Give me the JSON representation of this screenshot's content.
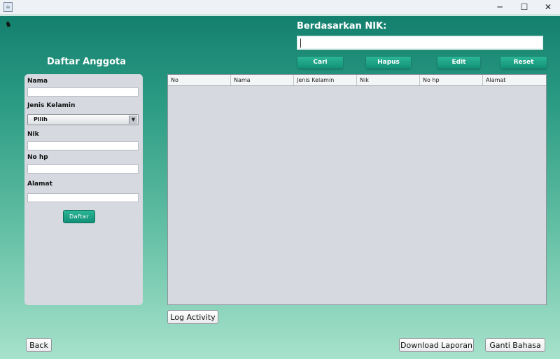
{
  "window": {
    "minimize_glyph": "─",
    "maximize_glyph": "☐",
    "close_glyph": "✕"
  },
  "search": {
    "heading": "Berdasarkan NIK:",
    "value": "",
    "buttons": {
      "cari": "Cari",
      "hapus": "Hapus",
      "edit": "Edit",
      "reset": "Reset"
    }
  },
  "form": {
    "title": "Daftar Anggota",
    "nama_label": "Nama",
    "nama_value": "",
    "jenis_kelamin_label": "Jenis Kelamin",
    "jenis_kelamin_selected": "Pilih",
    "nik_label": "Nik",
    "nik_value": "",
    "nohp_label": "No hp",
    "nohp_value": "",
    "alamat_label": "Alamat",
    "alamat_value": "",
    "submit_label": "Daftar"
  },
  "table": {
    "columns": [
      "No",
      "Nama",
      "Jenis Kelamin",
      "Nik",
      "No hp",
      "Alamat"
    ],
    "rows": []
  },
  "actions": {
    "log_activity": "Log Activity",
    "back": "Back",
    "download_laporan": "Download Laporan",
    "ganti_bahasa": "Ganti Bahasa"
  },
  "colors": {
    "accent": "#129077",
    "background_top": "#137f6d",
    "background_bottom": "#a7e2cc",
    "panel": "#d6d9df"
  }
}
